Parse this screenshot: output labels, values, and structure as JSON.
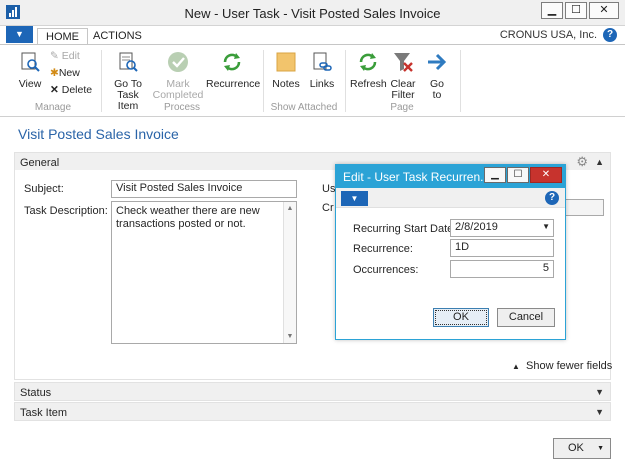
{
  "window": {
    "title": "New - User Task - Visit Posted Sales Invoice",
    "min": "▁",
    "max": "☐",
    "close": "✕"
  },
  "ribbon": {
    "tabs": [
      "HOME",
      "ACTIONS"
    ],
    "company": "CRONUS USA, Inc.",
    "help": "?",
    "manage": {
      "label": "Manage",
      "view": "View",
      "edit": "Edit",
      "new": "New",
      "delete": "Delete"
    },
    "process": {
      "label": "Process",
      "goto_task_1": "Go To",
      "goto_task_2": "Task Item",
      "mark_1": "Mark",
      "mark_2": "Completed",
      "recurrence": "Recurrence"
    },
    "show_attached": {
      "label": "Show Attached",
      "notes": "Notes",
      "links": "Links"
    },
    "page": {
      "label": "Page",
      "refresh": "Refresh",
      "clear_1": "Clear",
      "clear_2": "Filter",
      "goto_1": "Go",
      "goto_2": "to"
    }
  },
  "page": {
    "title": "Visit Posted Sales Invoice",
    "general": {
      "label": "General",
      "subject_label": "Subject:",
      "subject_value": "Visit Posted Sales Invoice",
      "desc_label": "Task Description:",
      "desc_value": "Check weather there are new transactions posted or not.",
      "right_label_1": "Us",
      "right_label_2": "Cr",
      "show_fewer": "Show fewer fields"
    },
    "status_label": "Status",
    "task_item_label": "Task Item",
    "ok": "OK"
  },
  "dialog": {
    "title": "Edit - User Task Recurren...",
    "start_label": "Recurring Start Date:",
    "start_value": "2/8/2019",
    "recurrence_label": "Recurrence:",
    "recurrence_value": "1D",
    "occurrences_label": "Occurrences:",
    "occurrences_value": "5",
    "ok": "OK",
    "cancel": "Cancel"
  },
  "colors": {
    "accent": "#1d66b7",
    "dialog": "#2ba3d6",
    "link_title": "#2a64a8",
    "close_red": "#c7332d"
  }
}
